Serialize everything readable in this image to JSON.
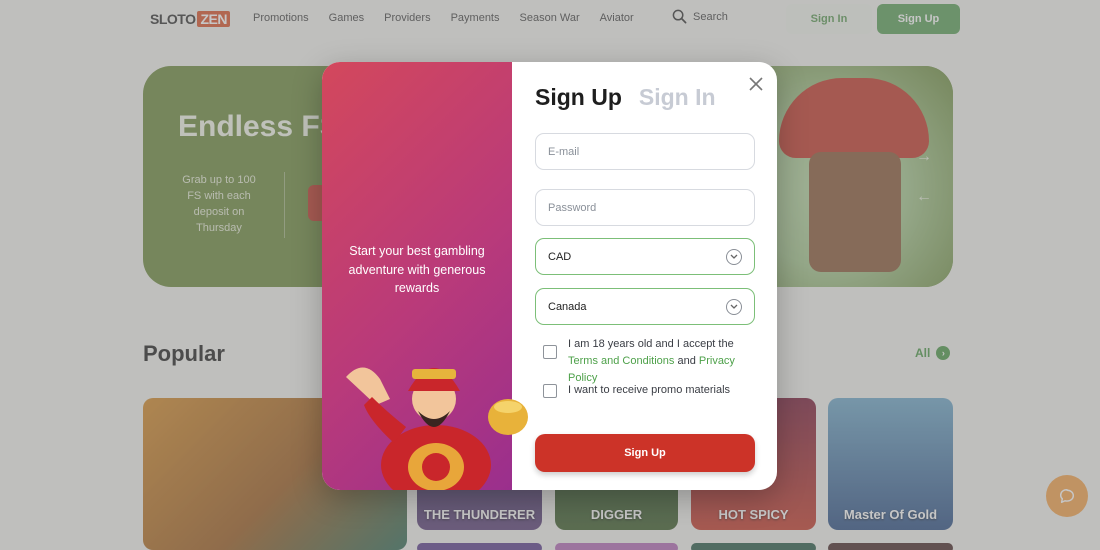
{
  "header": {
    "logo_prefix": "SLOTO",
    "logo_suffix": "ZEN",
    "nav": [
      "Promotions",
      "Games",
      "Providers",
      "Payments",
      "Season War",
      "Aviator"
    ],
    "search_label": "Search",
    "sign_in_label": "Sign In",
    "sign_up_label": "Sign Up"
  },
  "banner": {
    "title": "Endless FS",
    "subtitle": "Grab up to 100 FS with each deposit on Thursday"
  },
  "popular": {
    "title": "Popular",
    "all_label": "All",
    "tiles": [
      "THE THUNDERER",
      "DIGGER",
      "HOT SPICY",
      "Master Of Gold"
    ]
  },
  "modal": {
    "promo_text": "Start your best gambling adventure with generous rewards",
    "tab_active": "Sign Up",
    "tab_inactive": "Sign In",
    "email_placeholder": "E-mail",
    "password_placeholder": "Password",
    "currency_value": "CAD",
    "country_value": "Canada",
    "terms_prefix": "I am 18 years old and I accept the",
    "terms_link": "Terms and Conditions",
    "terms_and": "and",
    "privacy_link": "Privacy Policy",
    "promo_consent": "I want to receive promo materials",
    "submit_label": "Sign Up"
  },
  "colors": {
    "accent_green": "#5ca15a",
    "submit_red": "#cc3328",
    "promo_gradient_start": "#d3485c",
    "promo_gradient_end": "#9a2f8d"
  }
}
